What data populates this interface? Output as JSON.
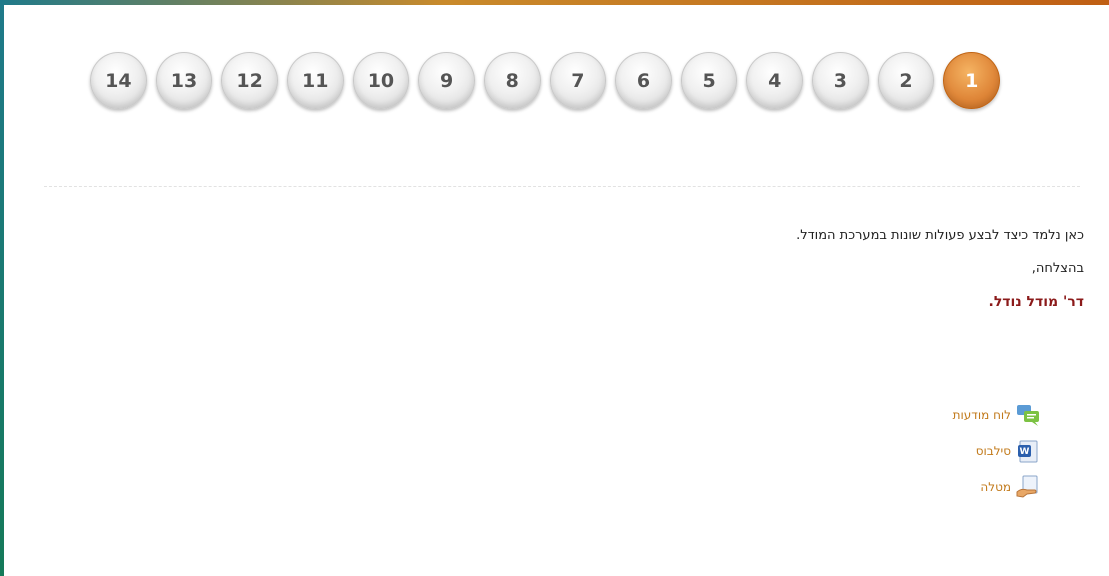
{
  "pager": {
    "active": "1",
    "pages": [
      "1",
      "2",
      "3",
      "4",
      "5",
      "6",
      "7",
      "8",
      "9",
      "10",
      "11",
      "12",
      "13",
      "14"
    ]
  },
  "content": {
    "intro": "כאן נלמד כיצד לבצע פעולות שונות במערכת המודל.",
    "greeting": "בהצלחה,",
    "signature": "דר' מודל נודל."
  },
  "activities": [
    {
      "label": "לוח מודעות",
      "icon": "forum-icon"
    },
    {
      "label": "סילבוס",
      "icon": "word-document-icon"
    },
    {
      "label": "מטלה",
      "icon": "assignment-icon"
    }
  ],
  "colors": {
    "active_page": "#e0883a",
    "link": "#c27a1b",
    "signature": "#8b1a1a"
  }
}
